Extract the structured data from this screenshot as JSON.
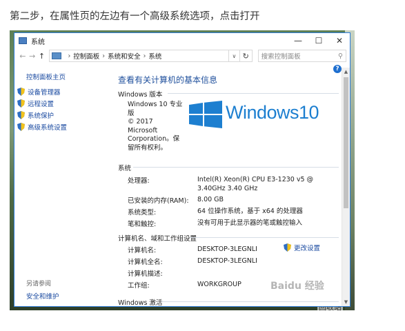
{
  "caption": "第二步，在属性页的左边有一个高级系统选项，点击打开",
  "desktop_label": "回收站",
  "window": {
    "title": "系统",
    "controls": {
      "minimize": "—",
      "maximize": "☐",
      "close": "✕"
    }
  },
  "address": {
    "back": "←",
    "forward": "→",
    "up": "↑",
    "crumbs": [
      "控制面板",
      "系统和安全",
      "系统"
    ],
    "separator": "›",
    "dropdown": "∨",
    "refresh": "↻",
    "search_placeholder": "搜索控制面板",
    "search_icon": "⚲"
  },
  "help": "?",
  "sidebar": {
    "home": "控制面板主页",
    "items": [
      {
        "label": "设备管理器",
        "icon": "shield-icon"
      },
      {
        "label": "远程设置",
        "icon": "shield-icon"
      },
      {
        "label": "系统保护",
        "icon": "shield-icon"
      },
      {
        "label": "高级系统设置",
        "icon": "shield-icon"
      }
    ],
    "see_also": "另请参阅",
    "security": "安全和维护"
  },
  "main": {
    "heading": "查看有关计算机的基本信息",
    "edition_section": "Windows 版本",
    "edition_lines": [
      "Windows 10 专业",
      "版",
      "© 2017",
      "Microsoft",
      "Corporation。保",
      "留所有权利。"
    ],
    "logo_text": "Windows10",
    "system_section": "系统",
    "system_rows": [
      {
        "label": "处理器:",
        "value": "Intel(R) Xeon(R) CPU E3-1230 v5 @ 3.40GHz   3.40 GHz"
      },
      {
        "label": "已安装的内存(RAM):",
        "value": "8.00 GB"
      },
      {
        "label": "系统类型:",
        "value": "64 位操作系统，基于 x64 的处理器"
      },
      {
        "label": "笔和触控:",
        "value": "没有可用于此显示器的笔或触控输入"
      }
    ],
    "computer_section": "计算机名、域和工作组设置",
    "computer_rows": [
      {
        "label": "计算机名:",
        "value": "DESKTOP-3LEGNLI"
      },
      {
        "label": "计算机全名:",
        "value": "DESKTOP-3LEGNLI"
      },
      {
        "label": "计算机描述:",
        "value": ""
      },
      {
        "label": "工作组:",
        "value": "WORKGROUP"
      }
    ],
    "change_settings": "更改设置",
    "activation_section": "Windows 激活"
  },
  "scroll": {
    "up": "▲",
    "down": "▼"
  },
  "watermark": "Baidu 经验",
  "colors": {
    "accent": "#1d7fd0",
    "link": "#1a4aa0",
    "heading": "#1e4f9c",
    "window_border": "#2b7bd8"
  }
}
